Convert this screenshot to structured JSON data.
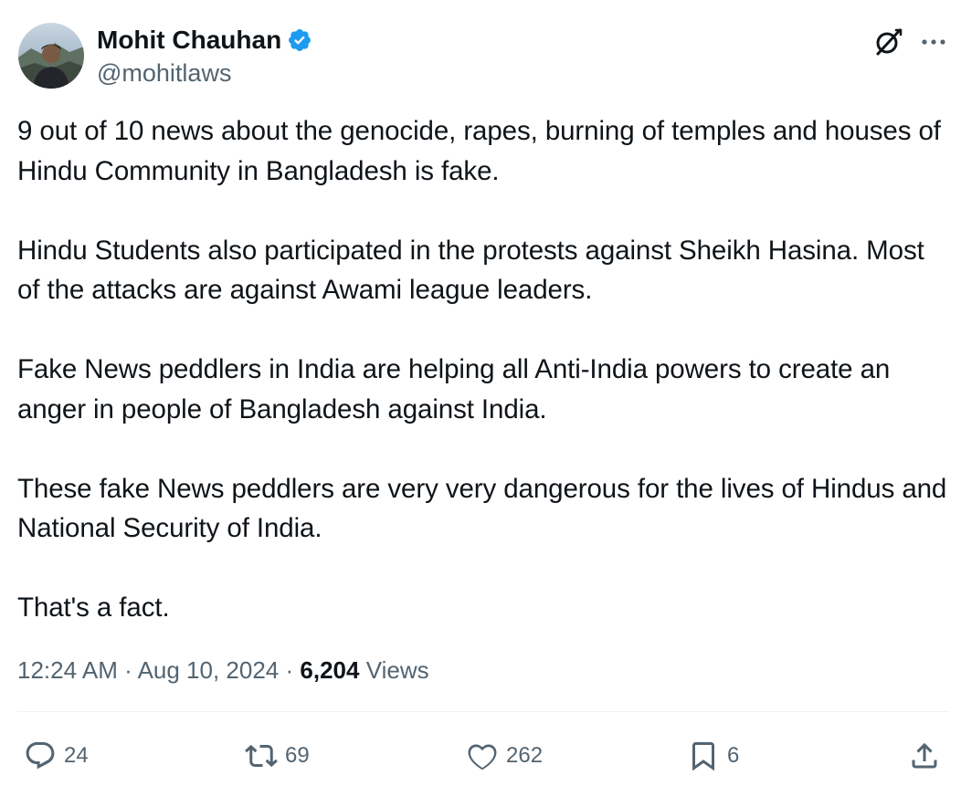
{
  "author": {
    "display_name": "Mohit Chauhan",
    "handle": "@mohitlaws",
    "verified": true
  },
  "tweet": {
    "paragraphs": [
      "9 out of 10 news about the genocide, rapes, burning of temples and houses of Hindu Community in Bangladesh is fake.",
      "Hindu Students also participated in the protests against Sheikh Hasina. Most of the attacks are against Awami league leaders.",
      "Fake News peddlers in India are helping all Anti-India powers to create an anger in people of Bangladesh against India.",
      "These fake News peddlers are very very dangerous for the lives of Hindus and National Security of India.",
      "That's a fact."
    ],
    "time": "12:24 AM",
    "date": "Aug 10, 2024",
    "separator": "·",
    "views_count": "6,204",
    "views_label": "Views"
  },
  "actions": {
    "replies": "24",
    "reposts": "69",
    "likes": "262",
    "bookmarks": "6"
  },
  "colors": {
    "text": "#0f1419",
    "secondary": "#536471",
    "verified": "#1d9bf0",
    "divider": "#eff3f4"
  },
  "icons": [
    "verified-badge-icon",
    "grok-icon",
    "more-icon",
    "reply-icon",
    "repost-icon",
    "like-icon",
    "bookmark-icon",
    "share-icon"
  ]
}
